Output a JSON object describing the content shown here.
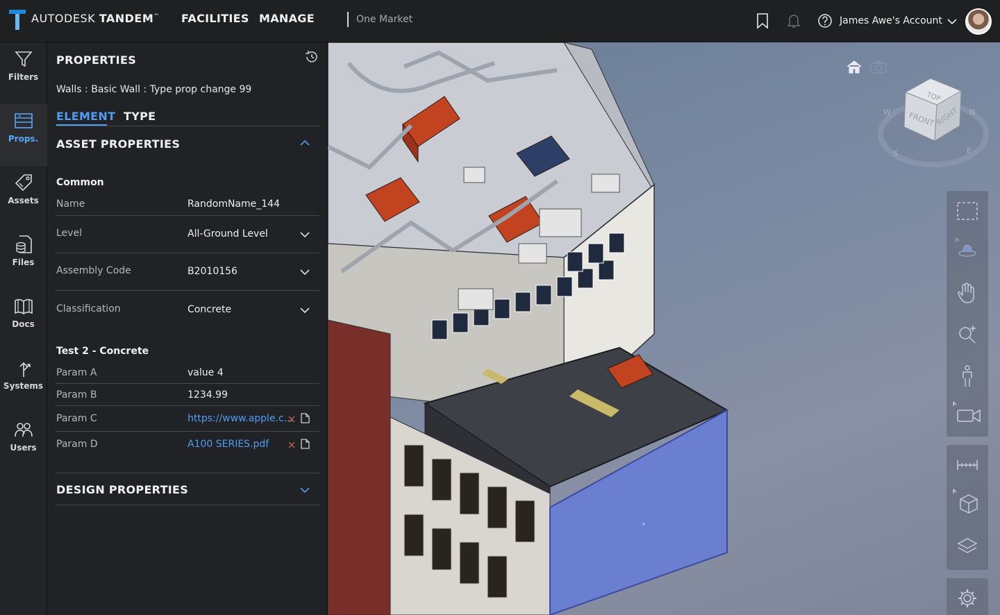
{
  "header": {
    "brand_first": "AUTODESK",
    "brand_second": "TANDEM",
    "brand_mark": "™",
    "nav": [
      "FACILITIES",
      "MANAGE"
    ],
    "facility_name": "One Market",
    "account_label": "James Awe's Account"
  },
  "rail": {
    "items": [
      {
        "label": "Filters",
        "icon": "filter-icon"
      },
      {
        "label": "Props.",
        "icon": "properties-icon",
        "active": true
      },
      {
        "label": "Assets",
        "icon": "tag-icon"
      },
      {
        "label": "Files",
        "icon": "file-database-icon"
      },
      {
        "label": "Docs",
        "icon": "book-icon"
      },
      {
        "label": "Systems",
        "icon": "systems-icon"
      },
      {
        "label": "Users",
        "icon": "users-icon"
      }
    ]
  },
  "panel": {
    "title": "PROPERTIES",
    "element_name": "Walls : Basic Wall : Type prop change 99",
    "tabs": [
      "ELEMENT",
      "TYPE"
    ],
    "active_tab": "ELEMENT",
    "asset_section": "ASSET PROPERTIES",
    "groups": [
      {
        "name": "Common",
        "rows": [
          {
            "name": "Name",
            "value": "RandomName_144"
          },
          {
            "name": "Level",
            "value": "All-Ground Level",
            "dropdown": true
          },
          {
            "name": "Assembly Code",
            "value": "B2010156",
            "dropdown": true
          },
          {
            "name": "Classification",
            "value": "Concrete",
            "dropdown": true
          }
        ]
      },
      {
        "name": "Test 2 - Concrete",
        "rows": [
          {
            "name": "Param A",
            "value": "value 4"
          },
          {
            "name": "Param B",
            "value": "1234.99"
          },
          {
            "name": "Param C",
            "value": "https://www.apple.c...",
            "link": true
          },
          {
            "name": "Param D",
            "value": "A100 SERIES.pdf",
            "link": true
          }
        ]
      }
    ],
    "design_section": "DESIGN PROPERTIES"
  },
  "viewcube": {
    "faces": [
      "TOP",
      "FRONT",
      "RIGHT"
    ],
    "compass": [
      "W",
      "N",
      "S",
      "E"
    ]
  },
  "colors": {
    "accent": "#4f9df2",
    "topbar": "#1f2022",
    "panel": "#222326",
    "delete": "#d9534f",
    "equipment_orange": "#c2431f",
    "selected_wall": "#6a7fd0"
  }
}
